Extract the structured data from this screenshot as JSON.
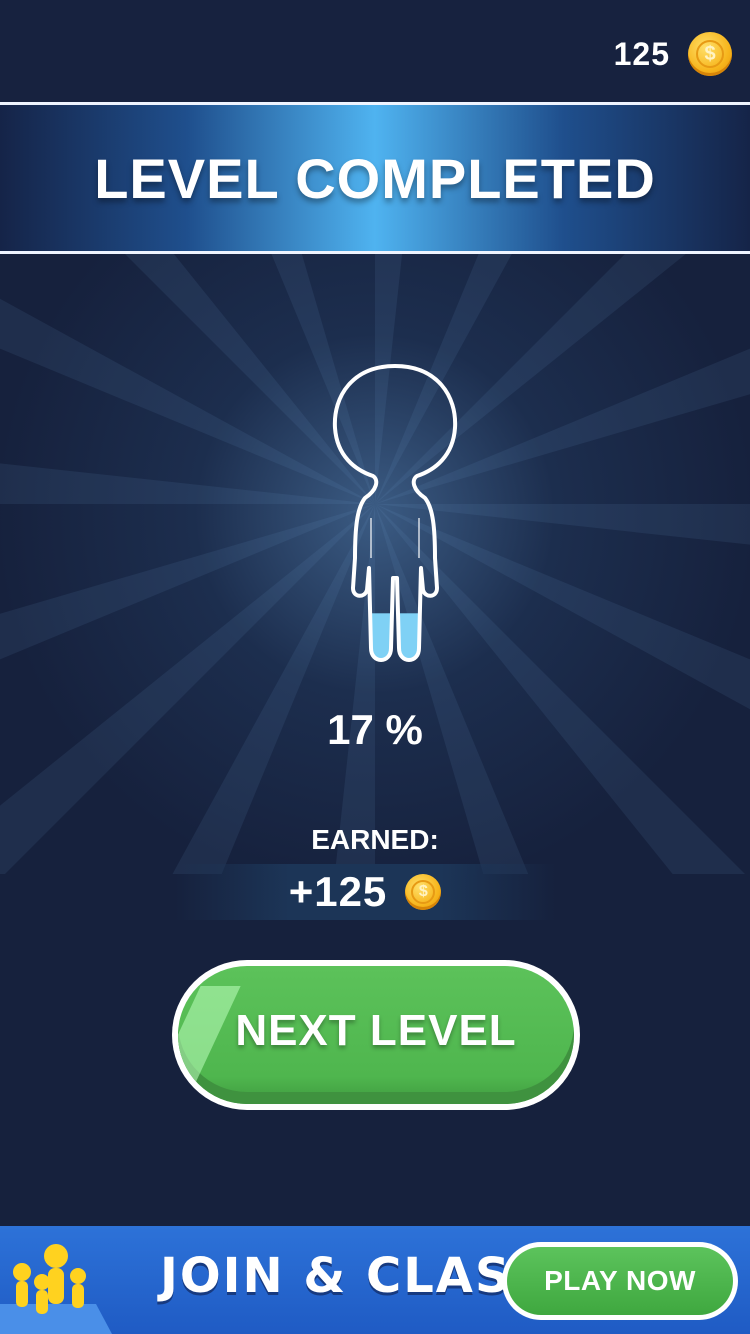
{
  "header": {
    "coin_count": "125"
  },
  "banner": {
    "title": "LEVEL COMPLETED"
  },
  "result": {
    "percent_text": "17 %",
    "fill_fraction": 0.17,
    "earned_label": "EARNED:",
    "earned_value": "+125"
  },
  "actions": {
    "next_level_label": "NEXT LEVEL"
  },
  "ad": {
    "title": "JOIN & CLASH",
    "cta_label": "PLAY NOW"
  },
  "colors": {
    "background": "#16213d",
    "banner_center": "#4fb3f0",
    "button_green": "#55ba53",
    "fill_blue": "#7fd1f5",
    "coin_gold": "#f7b51c",
    "ad_blue": "#2d72d8"
  },
  "icons": {
    "coin": "coin-icon",
    "figure": "stickman-silhouette-icon",
    "ad_art": "crowd-runners-icon"
  }
}
